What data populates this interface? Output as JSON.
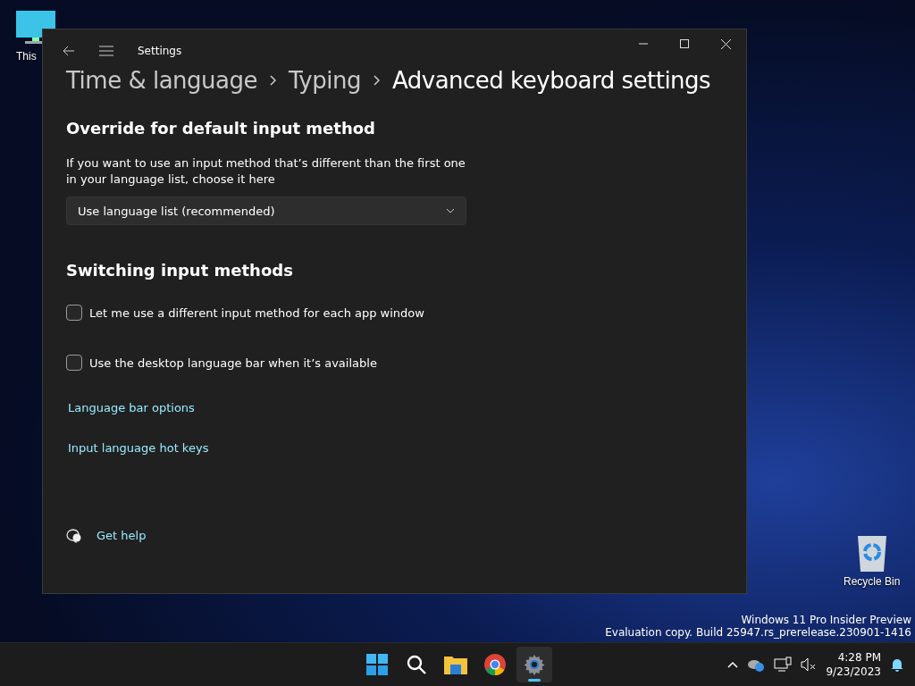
{
  "desktop_icons": [
    {
      "kind": "pc",
      "label": "This"
    },
    {
      "kind": "bin",
      "label": "Recycle Bin"
    }
  ],
  "window": {
    "title": "Settings",
    "breadcrumb": [
      {
        "label": "Time & language",
        "current": false
      },
      {
        "label": "Typing",
        "current": false
      },
      {
        "label": "Advanced keyboard settings",
        "current": true
      }
    ],
    "sections": [
      {
        "heading": "Override for default input method",
        "description": "If you want to use an input method that’s different than the first one in your language list, choose it here",
        "dropdown": {
          "value": "Use language list (recommended)"
        }
      },
      {
        "heading": "Switching input methods",
        "checkboxes": [
          {
            "label": "Let me use a different input method for each app window",
            "checked": false
          },
          {
            "label": "Use the desktop language bar when it’s available",
            "checked": false
          }
        ],
        "links": [
          "Language bar options",
          "Input language hot keys"
        ]
      }
    ],
    "help_link": "Get help"
  },
  "watermark_lines": [
    "Windows 11 Pro Insider Preview",
    "Evaluation copy. Build 25947.rs_prerelease.230901-1416"
  ],
  "taskbar": {
    "apps": [
      {
        "kind": "start",
        "active": false
      },
      {
        "kind": "search",
        "active": false
      },
      {
        "kind": "files",
        "active": false
      },
      {
        "kind": "browser",
        "active": false
      },
      {
        "kind": "settings",
        "active": true
      }
    ],
    "time": "4:28 PM",
    "date": "9/23/2023"
  }
}
